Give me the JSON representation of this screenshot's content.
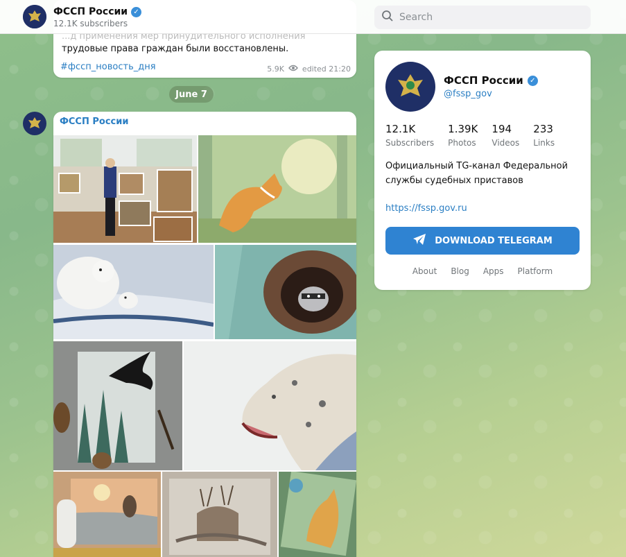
{
  "header": {
    "channel_name": "ФССП России",
    "subscribers": "12.1K subscribers",
    "search_placeholder": "Search"
  },
  "message1": {
    "text_line1": "...д применения мер принудительного исполнения",
    "text_line2": "трудовые права граждан были восстановлены.",
    "hashtag": "#фссп_новость_дня",
    "views": "5.9K",
    "edited": "edited 21:20"
  },
  "date_separator": "June 7",
  "message2": {
    "author": "ФССП России",
    "photos": [
      {
        "subject": "exhibition-room"
      },
      {
        "subject": "fox-painting"
      },
      {
        "subject": "polar-bears-painting"
      },
      {
        "subject": "raccoon-painting"
      },
      {
        "subject": "raven-forest-painting"
      },
      {
        "subject": "snow-leopard-painting"
      },
      {
        "subject": "owl-sunset-painting"
      },
      {
        "subject": "deer-painting"
      },
      {
        "subject": "wolf-painting"
      }
    ]
  },
  "card": {
    "name": "ФССП России",
    "username": "@fssp_gov",
    "stats": [
      {
        "num": "12.1K",
        "label": "Subscribers"
      },
      {
        "num": "1.39K",
        "label": "Photos"
      },
      {
        "num": "194",
        "label": "Videos"
      },
      {
        "num": "233",
        "label": "Links"
      }
    ],
    "description": "Официальный TG-канал Федеральной службы судебных приставов",
    "link": "https://fssp.gov.ru",
    "download_label": "DOWNLOAD TELEGRAM",
    "footer": [
      "About",
      "Blog",
      "Apps",
      "Platform"
    ]
  },
  "colors": {
    "accent": "#2f83d2",
    "link": "#2a7ec3",
    "emblem_bg": "#1f2f66"
  }
}
